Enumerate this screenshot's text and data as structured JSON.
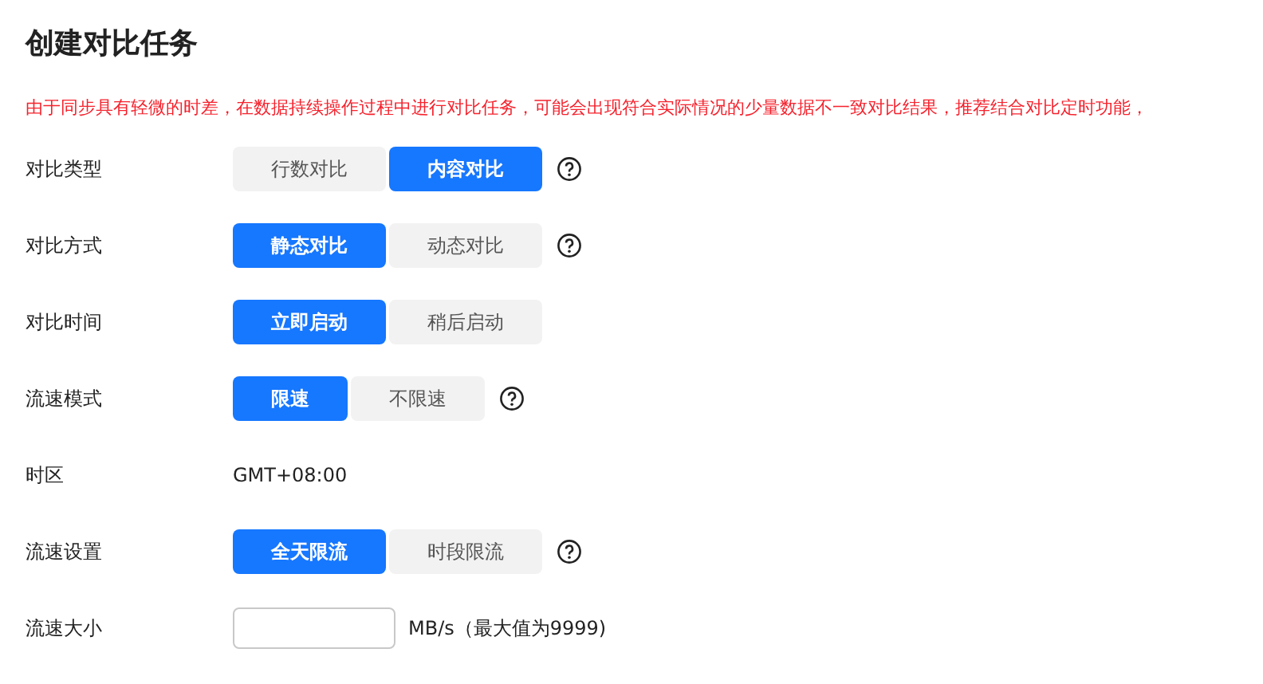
{
  "title": "创建对比任务",
  "warning": "由于同步具有轻微的时差，在数据持续操作过程中进行对比任务，可能会出现符合实际情况的少量数据不一致对比结果，推荐结合对比定时功能，",
  "rows": [
    {
      "kind": "segmented",
      "label": "对比类型",
      "help": true,
      "options": [
        {
          "label": "行数对比",
          "selected": false
        },
        {
          "label": "内容对比",
          "selected": true
        }
      ]
    },
    {
      "kind": "segmented",
      "label": "对比方式",
      "help": true,
      "options": [
        {
          "label": "静态对比",
          "selected": true
        },
        {
          "label": "动态对比",
          "selected": false
        }
      ]
    },
    {
      "kind": "segmented",
      "label": "对比时间",
      "help": false,
      "options": [
        {
          "label": "立即启动",
          "selected": true
        },
        {
          "label": "稍后启动",
          "selected": false
        }
      ]
    },
    {
      "kind": "segmented",
      "label": "流速模式",
      "help": true,
      "options": [
        {
          "label": "限速",
          "selected": true
        },
        {
          "label": "不限速",
          "selected": false
        }
      ]
    },
    {
      "kind": "text",
      "label": "时区",
      "value": "GMT+08:00"
    },
    {
      "kind": "segmented",
      "label": "流速设置",
      "help": true,
      "options": [
        {
          "label": "全天限流",
          "selected": true
        },
        {
          "label": "时段限流",
          "selected": false
        }
      ]
    },
    {
      "kind": "input",
      "label": "流速大小",
      "unit": "MB/s（最大值为9999)"
    }
  ]
}
